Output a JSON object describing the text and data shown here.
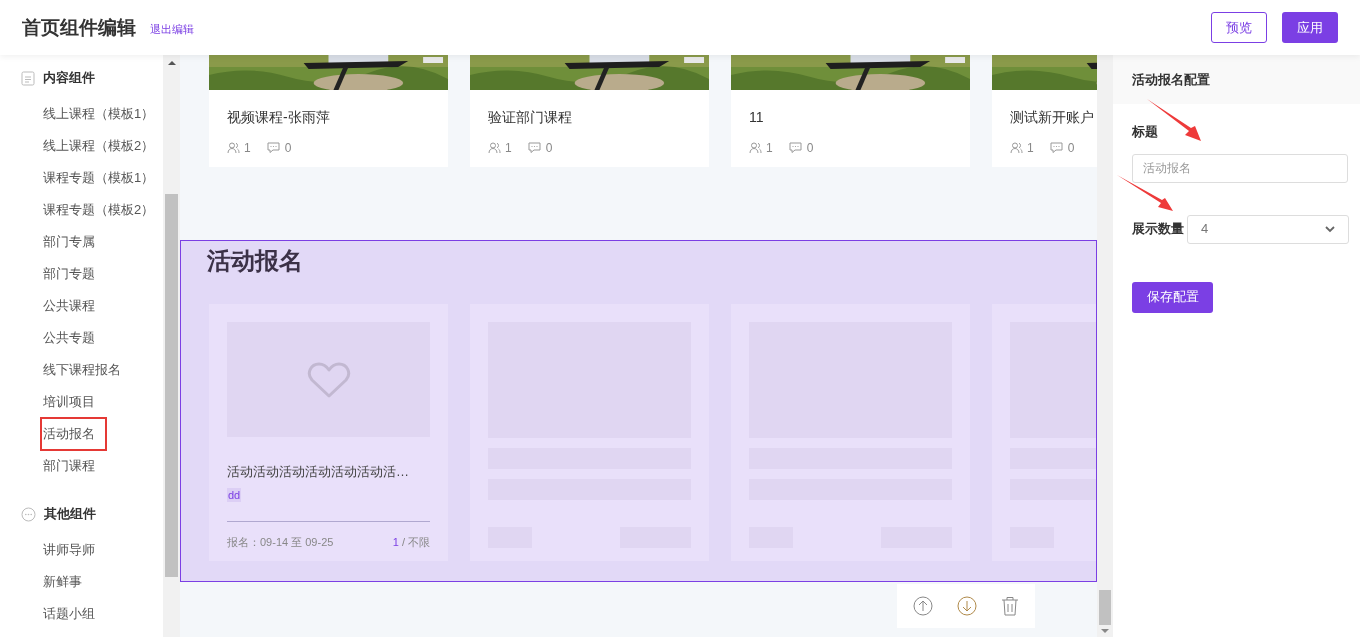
{
  "header": {
    "title": "首页组件编辑",
    "exit_link": "退出编辑",
    "buttons": [
      {
        "label": "预览",
        "kind": "outline"
      },
      {
        "label": "应用",
        "kind": "primary"
      }
    ]
  },
  "sidebar": {
    "groups": [
      {
        "title": "内容组件",
        "kind": "content",
        "items": [
          {
            "label": "线上课程（模板1）",
            "highlighted": false
          },
          {
            "label": "线上课程（模板2）",
            "highlighted": false
          },
          {
            "label": "课程专题（模板1）",
            "highlighted": false
          },
          {
            "label": "课程专题（模板2）",
            "highlighted": false
          },
          {
            "label": "部门专属",
            "highlighted": false
          },
          {
            "label": "部门专题",
            "highlighted": false
          },
          {
            "label": "公共课程",
            "highlighted": false
          },
          {
            "label": "公共专题",
            "highlighted": false
          },
          {
            "label": "线下课程报名",
            "highlighted": false
          },
          {
            "label": "培训项目",
            "highlighted": false
          },
          {
            "label": "活动报名",
            "highlighted": true
          },
          {
            "label": "部门课程",
            "highlighted": false
          }
        ]
      },
      {
        "title": "其他组件",
        "kind": "other",
        "items": [
          {
            "label": "讲师导师",
            "highlighted": false
          },
          {
            "label": "新鲜事",
            "highlighted": false
          },
          {
            "label": "话题小组",
            "highlighted": false
          }
        ]
      }
    ]
  },
  "course_cards": [
    {
      "title": "视频课程-张雨萍",
      "learners": "1",
      "comments": "0"
    },
    {
      "title": "验证部门课程",
      "learners": "1",
      "comments": "0"
    },
    {
      "title": "11",
      "learners": "1",
      "comments": "0"
    },
    {
      "title": "测试新开账户",
      "learners": "1",
      "comments": "0"
    }
  ],
  "section": {
    "title": "活动报名",
    "selected": true,
    "cards": [
      {
        "kind": "activity",
        "title": "活动活动活动活动活动活动活…",
        "tag": "dd",
        "date": "报名：09-14 至 09-25",
        "count": "1",
        "limit": "/ 不限"
      },
      {
        "kind": "placeholder"
      },
      {
        "kind": "placeholder"
      },
      {
        "kind": "placeholder"
      }
    ]
  },
  "config": {
    "title": "活动报名配置",
    "fields": [
      {
        "kind": "text",
        "label": "标题",
        "placeholder": "活动报名"
      },
      {
        "kind": "select",
        "label": "展示数量",
        "value": "4"
      }
    ],
    "save_button": "保存配置"
  }
}
